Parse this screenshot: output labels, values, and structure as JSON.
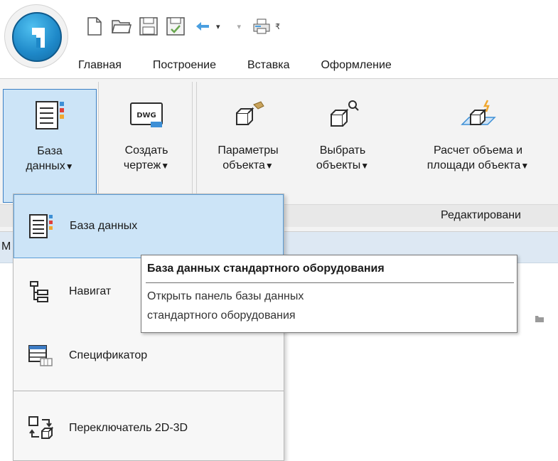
{
  "quick_access": {
    "icons": [
      "new-file-icon",
      "open-folder-icon",
      "save-icon",
      "save-all-icon",
      "undo-icon",
      "redo-icon",
      "print-icon",
      "customize-icon"
    ]
  },
  "tabs": [
    "Главная",
    "Построение",
    "Вставка",
    "Оформление"
  ],
  "ribbon": {
    "buttons": [
      {
        "line1": "База",
        "line2": "данных",
        "icon": "database-icon"
      },
      {
        "line1": "Создать",
        "line2": "чертеж",
        "icon": "dwg-icon"
      },
      {
        "line1": "Параметры",
        "line2": "объекта",
        "icon": "object-params-icon"
      },
      {
        "line1": "Выбрать",
        "line2": "объекты",
        "icon": "select-objects-icon"
      },
      {
        "line1": "Расчет объема и",
        "line2": "площади объекта",
        "icon": "volume-calc-icon"
      }
    ],
    "group_name": "Редактировани"
  },
  "background": {
    "bar_text": "М"
  },
  "menu": {
    "items": [
      {
        "label": "База данных",
        "icon": "database-icon"
      },
      {
        "label": "Навигат",
        "icon": "tree-icon"
      },
      {
        "label": "Спецификатор",
        "icon": "table-icon"
      },
      {
        "label": "Переключатель 2D-3D",
        "icon": "switch-2d3d-icon"
      }
    ]
  },
  "tooltip": {
    "title": "База данных стандартного оборудования",
    "desc_line1": "Открыть панель базы данных",
    "desc_line2": "стандартного оборудования"
  },
  "colors": {
    "highlight": "#cce4f7",
    "highlight_border": "#3c80c4",
    "accent_blue": "#1e88c8"
  }
}
